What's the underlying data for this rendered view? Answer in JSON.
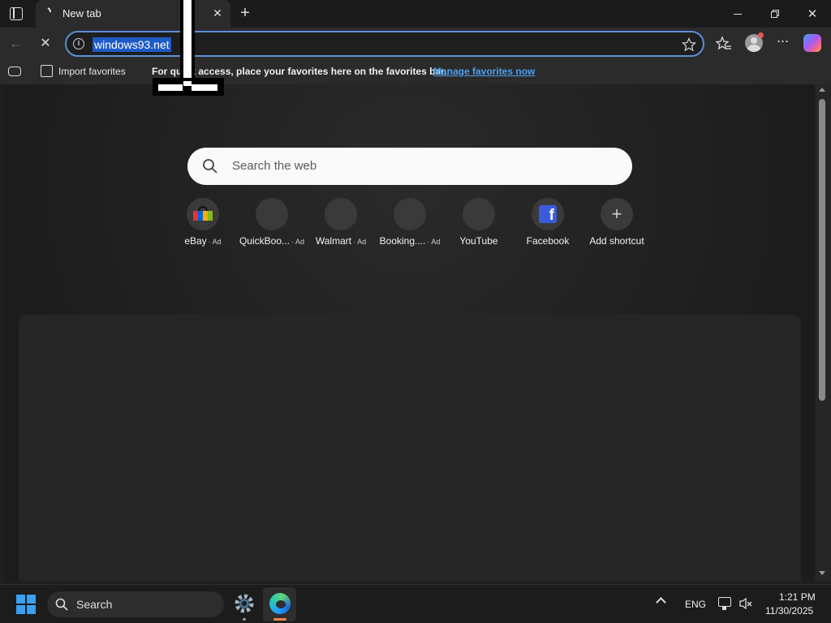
{
  "tab": {
    "title": "New tab"
  },
  "address": {
    "url": "windows93.net"
  },
  "favorites_bar": {
    "import_label": "Import favorites",
    "prompt_text": "For quick access, place your favorites here on the favorites bar.",
    "manage_link": "Manage favorites now"
  },
  "search": {
    "placeholder": "Search the web"
  },
  "shortcuts": [
    {
      "label": "eBay",
      "ad": "· Ad"
    },
    {
      "label": "QuickBoo...",
      "ad": "· Ad"
    },
    {
      "label": "Walmart",
      "ad": "· Ad"
    },
    {
      "label": "Booking....",
      "ad": "· Ad"
    },
    {
      "label": "YouTube",
      "ad": ""
    },
    {
      "label": "Facebook",
      "ad": ""
    },
    {
      "label": "Add shortcut",
      "ad": ""
    }
  ],
  "taskbar": {
    "search_label": "Search",
    "language": "ENG",
    "time": "1:21 PM",
    "date": "11/30/2025"
  },
  "colors": {
    "accent": "#1e5bc6",
    "link": "#4ea1f3",
    "address_border": "#5b8fd9"
  }
}
